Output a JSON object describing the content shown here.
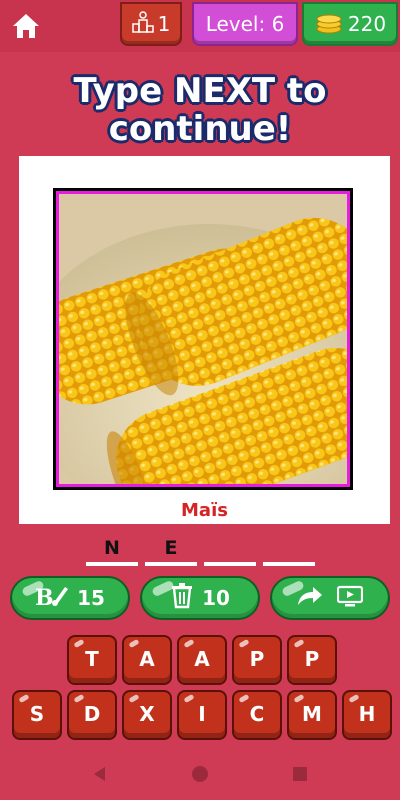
{
  "topbar": {
    "rank": "1",
    "level_label": "Level: 6",
    "coins": "220"
  },
  "headline": {
    "line1": "Type NEXT to",
    "line2": "continue!"
  },
  "puzzle": {
    "image_alt": "corn-on-the-cob",
    "caption": "Maïs",
    "answer_slots": [
      "N",
      "E",
      "",
      ""
    ]
  },
  "helpers": {
    "reveal_count": "15",
    "remove_count": "10"
  },
  "keyboard": {
    "row1": [
      "T",
      "A",
      "A",
      "P",
      "P"
    ],
    "row2": [
      "S",
      "D",
      "X",
      "I",
      "C",
      "M",
      "H"
    ]
  },
  "colors": {
    "background": "#cf3a54",
    "green": "#2fb14e",
    "key_red": "#c2311b",
    "level_purple": "#d24ed6"
  }
}
